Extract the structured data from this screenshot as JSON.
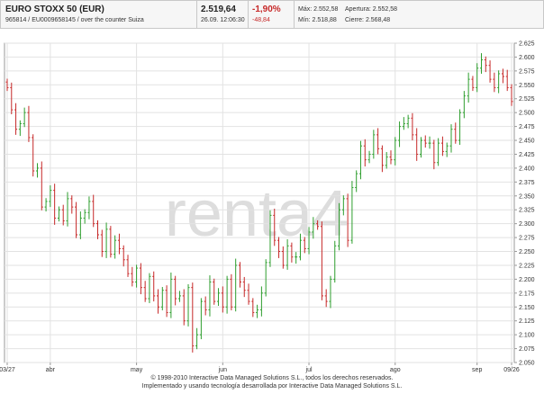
{
  "header": {
    "name": "EURO STOXX 50 (EUR)",
    "codes": "965814 / EU0009658145 / over the counter Suiza",
    "last": "2.519,64",
    "datetime": "26.09. 12:06:30",
    "change_pct": "-1,90%",
    "change_abs": "-48,84",
    "max_label": "Máx: 2.552,58",
    "open_label": "Apertura: 2.552,58",
    "min_label": "Mín: 2.518,88",
    "close_label": "Cierre: 2.568,48"
  },
  "watermark": "renta4",
  "footer": {
    "line1": "© 1998-2010 Interactive Data Managed Solutions S.L., todos los derechos reservados.",
    "line2": "Implementado y usando tecnología desarrollada por Interactive Data Managed Solutions S.L."
  },
  "colors": {
    "up": "#2e9e2e",
    "down": "#c62828",
    "grid": "#e2e2e2",
    "axis": "#999999"
  },
  "chart_data": {
    "type": "ohlc",
    "title": "",
    "xlabel": "",
    "ylabel": "",
    "ylim": [
      2050,
      2625
    ],
    "yticks": [
      "2.625",
      "2.600",
      "2.575",
      "2.550",
      "2.525",
      "2.500",
      "2.475",
      "2.450",
      "2.425",
      "2.400",
      "2.375",
      "2.350",
      "2.325",
      "2.300",
      "2.275",
      "2.250",
      "2.225",
      "2.200",
      "2.175",
      "2.150",
      "2.125",
      "2.100",
      "2.075",
      "2.050"
    ],
    "xticks": [
      {
        "label": "03/27",
        "index": 0
      },
      {
        "label": "abr",
        "index": 10
      },
      {
        "label": "may",
        "index": 30
      },
      {
        "label": "jun",
        "index": 50
      },
      {
        "label": "jul",
        "index": 70
      },
      {
        "label": "ago",
        "index": 90
      },
      {
        "label": "sep",
        "index": 109
      },
      {
        "label": "09/26",
        "index": 117
      }
    ],
    "grid": true,
    "close": [
      2545,
      2505,
      2470,
      2480,
      2500,
      2455,
      2395,
      2400,
      2330,
      2340,
      2360,
      2310,
      2325,
      2305,
      2345,
      2330,
      2280,
      2310,
      2320,
      2340,
      2300,
      2280,
      2250,
      2290,
      2245,
      2270,
      2255,
      2235,
      2210,
      2195,
      2220,
      2185,
      2165,
      2205,
      2170,
      2150,
      2180,
      2140,
      2200,
      2165,
      2170,
      2125,
      2185,
      2080,
      2100,
      2160,
      2145,
      2195,
      2160,
      2175,
      2150,
      2200,
      2150,
      2225,
      2195,
      2180,
      2160,
      2140,
      2145,
      2175,
      2230,
      2315,
      2270,
      2250,
      2225,
      2260,
      2240,
      2240,
      2270,
      2255,
      2285,
      2300,
      2295,
      2170,
      2160,
      2200,
      2260,
      2325,
      2345,
      2270,
      2365,
      2390,
      2440,
      2415,
      2425,
      2460,
      2435,
      2405,
      2420,
      2415,
      2450,
      2475,
      2480,
      2490,
      2460,
      2425,
      2450,
      2445,
      2445,
      2410,
      2445,
      2430,
      2440,
      2470,
      2450,
      2500,
      2530,
      2560,
      2545,
      2580,
      2595,
      2585,
      2560,
      2545,
      2570,
      2565,
      2545,
      2520
    ]
  }
}
